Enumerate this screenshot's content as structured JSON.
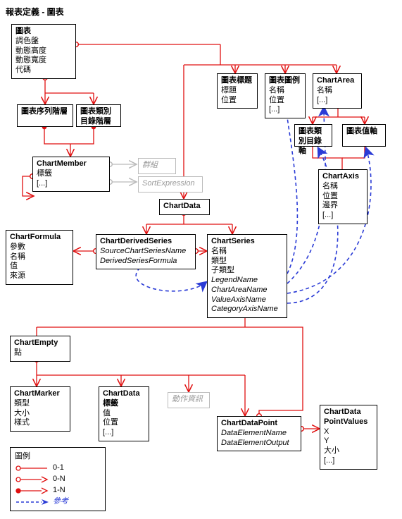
{
  "title": "報表定義 - 圖表",
  "nodes": {
    "chart": {
      "name": "圖表",
      "attrs": [
        "調色盤",
        "動態高度",
        "動態寬度",
        "代碼"
      ]
    },
    "seriesHierarchy": {
      "name": "圖表序列階層",
      "attrs": []
    },
    "categoryHierarchy": {
      "name": "圖表類別目錄階層",
      "attrs": []
    },
    "chartMember": {
      "name": "ChartMember",
      "attrs": [
        "標籤",
        "[...]"
      ]
    },
    "group": {
      "name": "群組",
      "attrs": []
    },
    "sortExpression": {
      "name": "SortExpression",
      "attrs": []
    },
    "chartTitle": {
      "name": "圖表標題",
      "attrs": [
        "標題",
        "位置"
      ]
    },
    "chartLegend": {
      "name": "圖表圖例",
      "attrs": [
        "名稱",
        "位置",
        "[...]"
      ]
    },
    "chartArea": {
      "name": "ChartArea",
      "attrs": [
        "名稱",
        "[...]"
      ]
    },
    "categoryAxis": {
      "name": "圖表類別目錄軸",
      "attrs": []
    },
    "valueAxis": {
      "name": "圖表值軸",
      "attrs": []
    },
    "chartAxis": {
      "name": "ChartAxis",
      "attrs": [
        "名稱",
        "位置",
        "邊界",
        "[...]"
      ]
    },
    "chartData": {
      "name": "ChartData",
      "attrs": []
    },
    "chartFormula": {
      "name": "ChartFormula",
      "attrs": [
        "參數",
        "名稱",
        "值",
        "來源"
      ]
    },
    "chartDerivedSeries": {
      "name": "ChartDerivedSeries",
      "attrs_i": [
        "SourceChartSeriesName",
        "DerivedSeriesFormula"
      ]
    },
    "chartSeries": {
      "name": "ChartSeries",
      "attrs": [
        "名稱",
        "類型",
        "子類型"
      ],
      "attrs_i": [
        "LegendName",
        "ChartAreaName",
        "ValueAxisName",
        "CategoryAxisName"
      ]
    },
    "chartEmpty": {
      "name": "ChartEmpty",
      "attrs": [
        "點"
      ]
    },
    "chartMarker": {
      "name": "ChartMarker",
      "attrs": [
        "類型",
        "大小",
        "樣式"
      ]
    },
    "chartDataLabel": {
      "name": "ChartData標籤",
      "attrs": [
        "值",
        "位置",
        "[...]"
      ]
    },
    "actionInfo": {
      "name": "動作資訊",
      "attrs": []
    },
    "chartDataPoint": {
      "name": "ChartDataPoint",
      "attrs_i": [
        "DataElementName",
        "DataElementOutput"
      ]
    },
    "chartDataPointValues": {
      "name": "ChartDataPointValues",
      "attrs": [
        "X",
        "Y",
        "大小",
        "[...]"
      ]
    }
  },
  "legend": {
    "title": "圖例",
    "items": [
      "0-1",
      "0-N",
      "1-N",
      "參考"
    ]
  },
  "colors": {
    "red": "#e01010",
    "blue": "#2a3bd6",
    "gray": "#bbbbbb"
  }
}
